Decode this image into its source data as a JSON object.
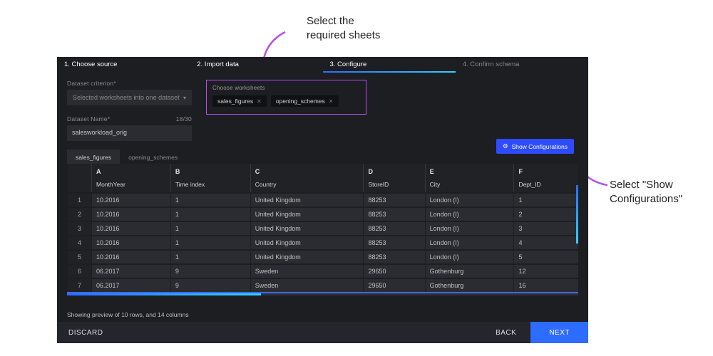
{
  "annotations": {
    "top": "Select the\nrequired sheets",
    "right": "Select \"Show\nConfigurations\""
  },
  "stepper": [
    {
      "label": "1. Choose source",
      "state": "active1"
    },
    {
      "label": "2. Import data",
      "state": "active2"
    },
    {
      "label": "3. Configure",
      "state": "active3"
    },
    {
      "label": "4. Confirm schema",
      "state": "future"
    }
  ],
  "left_panel": {
    "criteria_label": "Dataset criterion*",
    "criteria_value": "Selected worksheets into one dataset",
    "name_label": "Dataset Name*",
    "name_value": "salesworkload_orig",
    "name_counter": "18/30"
  },
  "worksheets": {
    "label": "Choose worksheets",
    "chips": [
      "sales_figures",
      "opening_schemes"
    ]
  },
  "show_config_label": "Show Configurations",
  "tabs": [
    {
      "label": "sales_figures",
      "active": true
    },
    {
      "label": "opening_schemes",
      "active": false
    }
  ],
  "table": {
    "col_letters": [
      "A",
      "B",
      "C",
      "D",
      "E",
      "F"
    ],
    "col_names": [
      "MonthYear",
      "Time index",
      "Country",
      "StoreID",
      "City",
      "Dept_ID"
    ],
    "rows": [
      [
        "10.2016",
        "1",
        "United Kingdom",
        "88253",
        "London (I)",
        "1"
      ],
      [
        "10.2016",
        "1",
        "United Kingdom",
        "88253",
        "London (I)",
        "2"
      ],
      [
        "10.2016",
        "1",
        "United Kingdom",
        "88253",
        "London (I)",
        "3"
      ],
      [
        "10.2016",
        "1",
        "United Kingdom",
        "88253",
        "London (I)",
        "4"
      ],
      [
        "10.2016",
        "1",
        "United Kingdom",
        "88253",
        "London (I)",
        "5"
      ],
      [
        "06.2017",
        "9",
        "Sweden",
        "29650",
        "Gothenburg",
        "12"
      ],
      [
        "06.2017",
        "9",
        "Sweden",
        "29650",
        "Gothenburg",
        "16"
      ]
    ]
  },
  "preview_note": "Showing preview of 10 rows, and 14 columns",
  "footer": {
    "discard": "DISCARD",
    "back": "BACK",
    "next": "NEXT"
  }
}
